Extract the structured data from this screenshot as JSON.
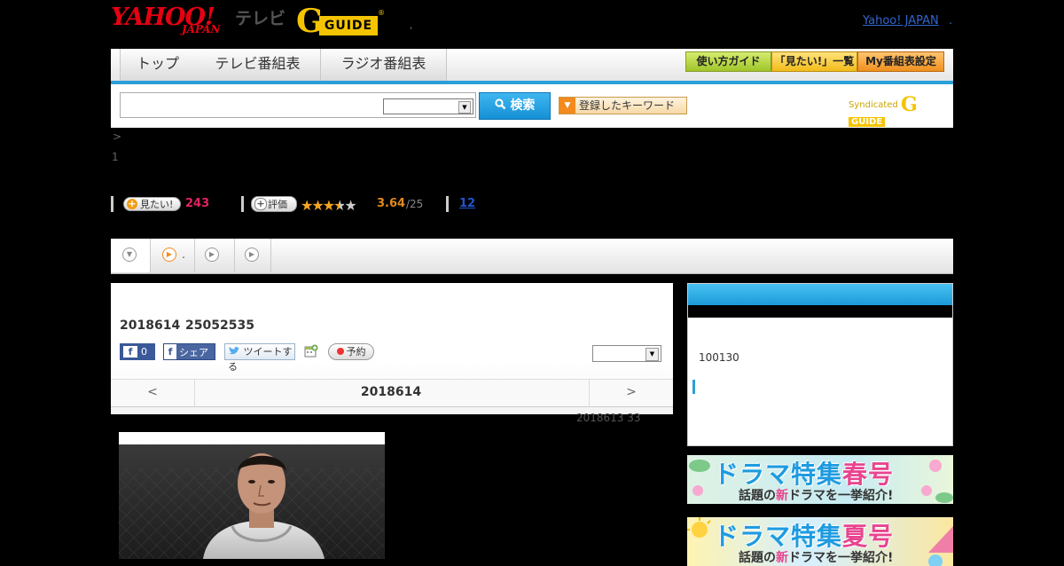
{
  "header": {
    "yahoo_logo_main": "YAHOO!",
    "yahoo_logo_sub": "JAPAN",
    "tv_label": "テレビ",
    "gguide_g": "G",
    "gguide_text": "GUIDE",
    "gguide_reg": "®",
    "dot": ",",
    "yahoo_japan_link": "Yahoo! JAPAN",
    "yahoo_japan_dot": "."
  },
  "nav": {
    "tabs": [
      "トップ",
      "テレビ番組表",
      "ラジオ番組表"
    ],
    "buttons": [
      "使い方ガイド",
      "「見たい!」一覧",
      "My番組表設定"
    ]
  },
  "search": {
    "input_value": "",
    "select_value": "",
    "button_label": "検索",
    "keyword_label": "登録したキーワード",
    "syndicated_label": "Syndicated",
    "syndicated_g": "G",
    "syndicated_guide": "GUIDE"
  },
  "crumb": {
    "arrow": ">",
    "number": "1"
  },
  "stats": {
    "want_label": "見たい!",
    "want_count": "243",
    "rate_label": "評価",
    "rating": "3.64",
    "rating_suffix": "/25",
    "review_count": "12"
  },
  "subtabs": {
    "dot": "."
  },
  "program": {
    "date": "2018614",
    "time": "25052535",
    "fb_count": "0",
    "fb_share": "シェア",
    "tweet": "ツイートする",
    "reserve": "予約",
    "select_value": "",
    "pager_prev": "<",
    "pager_date": "2018614",
    "pager_next": ">",
    "updated": "2018613  33"
  },
  "sidebar": {
    "box_text": "100130",
    "banner1_title_a": "ドラマ特集",
    "banner1_title_b": "春号",
    "banner1_sub_a": "話題の",
    "banner1_sub_b": "新",
    "banner1_sub_c": "ドラマを一挙紹介!",
    "banner2_title_a": "ドラマ特集",
    "banner2_title_b": "夏号",
    "banner2_sub_a": "話題の",
    "banner2_sub_b": "新",
    "banner2_sub_c": "ドラマを一挙紹介!"
  },
  "colors": {
    "accent_blue": "#2a9fd8",
    "want_count": "#e0245e",
    "rating_orange": "#e08a1e",
    "review_link": "#2255cc",
    "gguide_yellow": "#f5c400",
    "yahoo_red": "#e60012"
  }
}
